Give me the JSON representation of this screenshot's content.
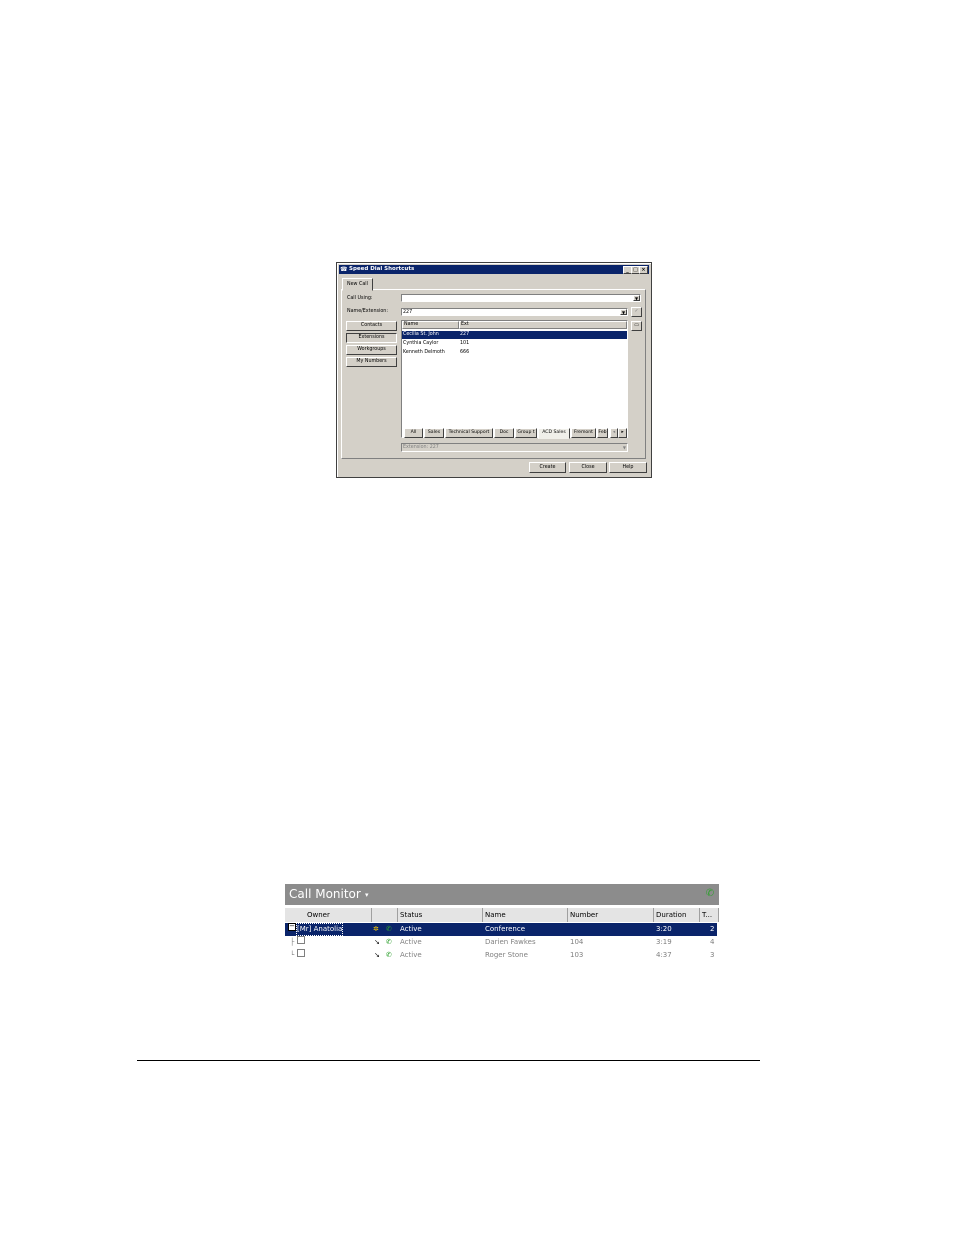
{
  "speed_dial": {
    "title": "Speed Dial Shortcuts",
    "window_buttons": [
      "_",
      "□",
      "×"
    ],
    "tab": "New Call",
    "call_using_label": "Call Using:",
    "call_using_value": "",
    "name_ext_label": "Name/Extension:",
    "name_ext_value": "227",
    "check_icon": "✓",
    "folder_icon": "▭",
    "side_buttons": [
      "Contacts",
      "Extensions",
      "Workgroups",
      "My Numbers"
    ],
    "list_headers": [
      "Name",
      "Ext"
    ],
    "rows": [
      {
        "name": "Cecilia St. John",
        "ext": "227"
      },
      {
        "name": "Cynthia Caylor",
        "ext": "101"
      },
      {
        "name": "Kenneth Delmoth",
        "ext": "666"
      }
    ],
    "group_tabs": [
      "All",
      "Sales",
      "Technical Support",
      "Doc",
      "Group t",
      "ACD Sales",
      "Fremont",
      "Feb"
    ],
    "tab_scroll": [
      "◂",
      "▸"
    ],
    "extension_field": "Extension: 227",
    "buttons": {
      "create": "Create",
      "close": "Close",
      "help": "Help"
    }
  },
  "call_monitor": {
    "title": "Call Monitor",
    "caret": "▾",
    "tool_icon": "✆",
    "columns": [
      "Owner",
      "",
      "Status",
      "Name",
      "Number",
      "Duration",
      "T..."
    ],
    "rows": [
      {
        "owner": "[Mr] Anatolia",
        "status": "Active",
        "name": "Conference",
        "number": "",
        "duration": "3:20",
        "t": "2"
      },
      {
        "owner": "",
        "status": "Active",
        "name": "Darien Fawkes",
        "number": "104",
        "duration": "3:19",
        "t": "4"
      },
      {
        "owner": "",
        "status": "Active",
        "name": "Roger Stone",
        "number": "103",
        "duration": "4:37",
        "t": "3"
      }
    ]
  },
  "colors": {
    "selection": "#0a246a",
    "dialog_face": "#d4d0c8",
    "monitor_header": "#8c8c8c",
    "active_phone": "#2ea02e"
  }
}
